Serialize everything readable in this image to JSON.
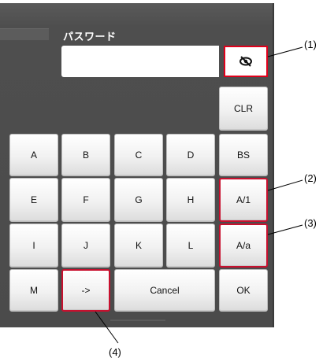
{
  "password": {
    "label": "パスワード",
    "value": "",
    "toggle_icon": "eye-slash-icon"
  },
  "keypad": {
    "clr": "CLR",
    "rows": [
      [
        "A",
        "B",
        "C",
        "D",
        "BS"
      ],
      [
        "E",
        "F",
        "G",
        "H",
        "A/1"
      ],
      [
        "I",
        "J",
        "K",
        "L",
        "A/a"
      ]
    ],
    "bottom": {
      "m": "M",
      "arrow": "->",
      "cancel": "Cancel",
      "ok": "OK"
    }
  },
  "callouts": [
    "(1)",
    "(2)",
    "(3)",
    "(4)"
  ],
  "colors": {
    "highlight": "#c8102e",
    "panel": "#4e4e4e",
    "key_face": "#f1f1f1"
  }
}
